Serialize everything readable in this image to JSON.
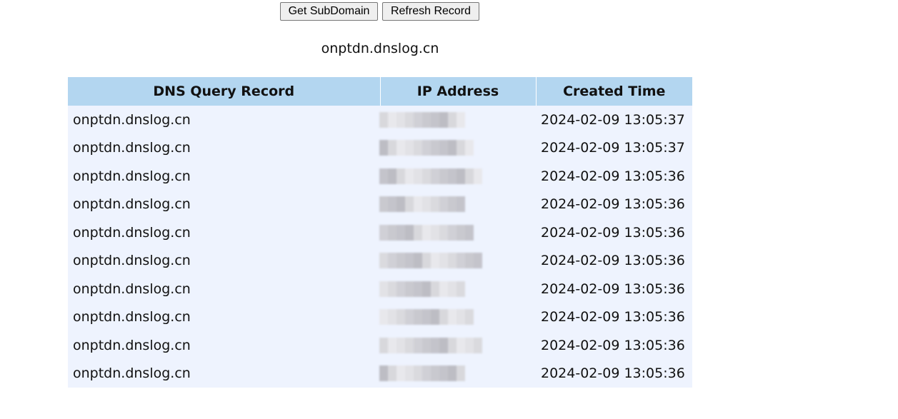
{
  "toolbar": {
    "get_subdomain_label": "Get SubDomain",
    "refresh_record_label": "Refresh Record"
  },
  "subdomain": "onptdn.dnslog.cn",
  "table": {
    "headers": [
      "DNS Query Record",
      "IP Address",
      "Created Time"
    ],
    "rows": [
      {
        "dns": "onptdn.dnslog.cn",
        "time": "2024-02-09 13:05:37"
      },
      {
        "dns": "onptdn.dnslog.cn",
        "time": "2024-02-09 13:05:37"
      },
      {
        "dns": "onptdn.dnslog.cn",
        "time": "2024-02-09 13:05:36"
      },
      {
        "dns": "onptdn.dnslog.cn",
        "time": "2024-02-09 13:05:36"
      },
      {
        "dns": "onptdn.dnslog.cn",
        "time": "2024-02-09 13:05:36"
      },
      {
        "dns": "onptdn.dnslog.cn",
        "time": "2024-02-09 13:05:36"
      },
      {
        "dns": "onptdn.dnslog.cn",
        "time": "2024-02-09 13:05:36"
      },
      {
        "dns": "onptdn.dnslog.cn",
        "time": "2024-02-09 13:05:36"
      },
      {
        "dns": "onptdn.dnslog.cn",
        "time": "2024-02-09 13:05:36"
      },
      {
        "dns": "onptdn.dnslog.cn",
        "time": "2024-02-09 13:05:36"
      }
    ]
  },
  "colors": {
    "header_bg": "#b3d6f0",
    "row_bg": "#eef3fe"
  }
}
